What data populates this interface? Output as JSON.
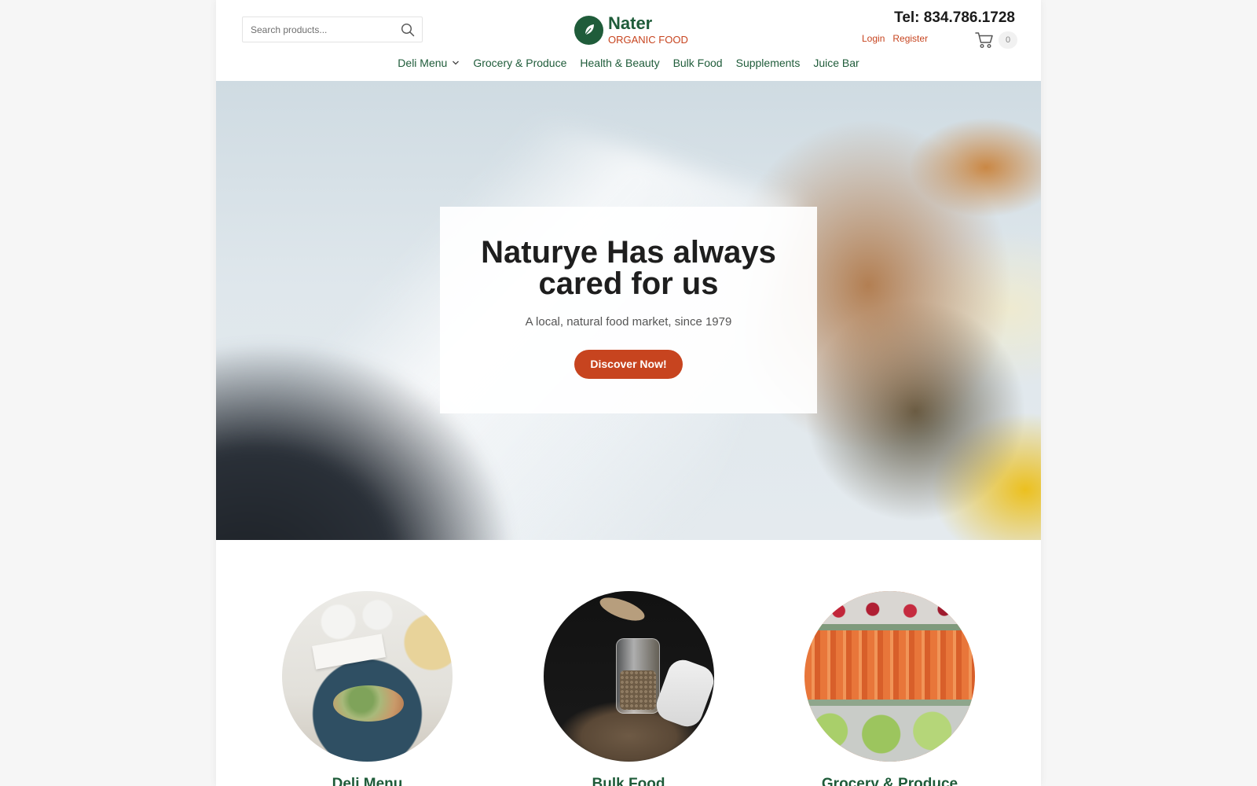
{
  "search": {
    "placeholder": "Search products..."
  },
  "logo": {
    "name": "Nater",
    "tagline": "ORGANIC FOOD"
  },
  "contact": {
    "tel": "Tel: 834.786.1728"
  },
  "account": {
    "login": "Login",
    "register": "Register"
  },
  "cart": {
    "count": "0"
  },
  "nav": {
    "items": [
      {
        "label": "Deli Menu",
        "has_dropdown": true
      },
      {
        "label": "Grocery & Produce"
      },
      {
        "label": "Health & Beauty"
      },
      {
        "label": "Bulk Food"
      },
      {
        "label": "Supplements"
      },
      {
        "label": "Juice Bar"
      }
    ]
  },
  "hero": {
    "title": "Naturye Has always cared for us",
    "subtitle": "A local, natural food market, since 1979",
    "button": "Discover Now!"
  },
  "categories": [
    {
      "title": "Deli Menu"
    },
    {
      "title": "Bulk Food"
    },
    {
      "title": "Grocery & Produce"
    }
  ],
  "colors": {
    "brand_green": "#1f5c3a",
    "accent_red": "#c7441f"
  }
}
